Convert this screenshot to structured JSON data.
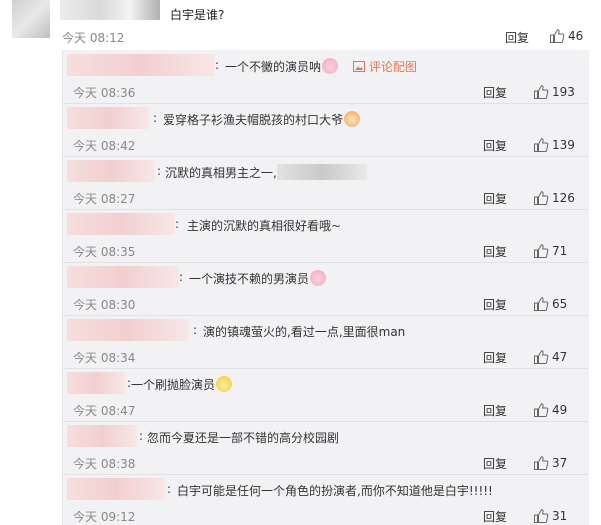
{
  "main_comment": {
    "text": "白宇是谁?",
    "time": "今天 08:12",
    "reply_label": "回复",
    "likes": "46"
  },
  "replies": [
    {
      "text": "一个不黴的演员呐",
      "emoji": "pink-face-emoji",
      "link": "评论配图",
      "time": "今天 08:36",
      "reply_label": "回复",
      "likes": "193"
    },
    {
      "text": "爱穿格子衫渔夫帽脱孩的村口大爷",
      "emoji": "cat-face-emoji",
      "time": "今天 08:42",
      "reply_label": "回复",
      "likes": "139"
    },
    {
      "text": "沉默的真相男主之一,",
      "time": "今天 08:27",
      "reply_label": "回复",
      "likes": "126"
    },
    {
      "text": "主演的沉默的真相很好看哦~",
      "time": "今天 08:35",
      "reply_label": "回复",
      "likes": "71"
    },
    {
      "text": "一个演技不赖的男演员",
      "emoji": "pink-face-emoji",
      "time": "今天 08:30",
      "reply_label": "回复",
      "likes": "65"
    },
    {
      "text": "演的镇魂萤火的,看过一点,里面很man",
      "time": "今天 08:34",
      "reply_label": "回复",
      "likes": "47"
    },
    {
      "text": "一个刷抛脸演员",
      "emoji": "yellow-face-emoji",
      "time": "今天 08:47",
      "reply_label": "回复",
      "likes": "49"
    },
    {
      "text": "忽而今夏还是一部不错的高分校园剧",
      "time": "今天 08:38",
      "reply_label": "回复",
      "likes": "37"
    },
    {
      "text": "白宇可能是任何一个角色的扮演者,而你不知道他是白宇!!!!!",
      "time": "今天 09:12",
      "reply_label": "回复",
      "likes": "31"
    }
  ],
  "colors": {
    "link": "#eb7350",
    "panel": "#f2f2f5"
  }
}
